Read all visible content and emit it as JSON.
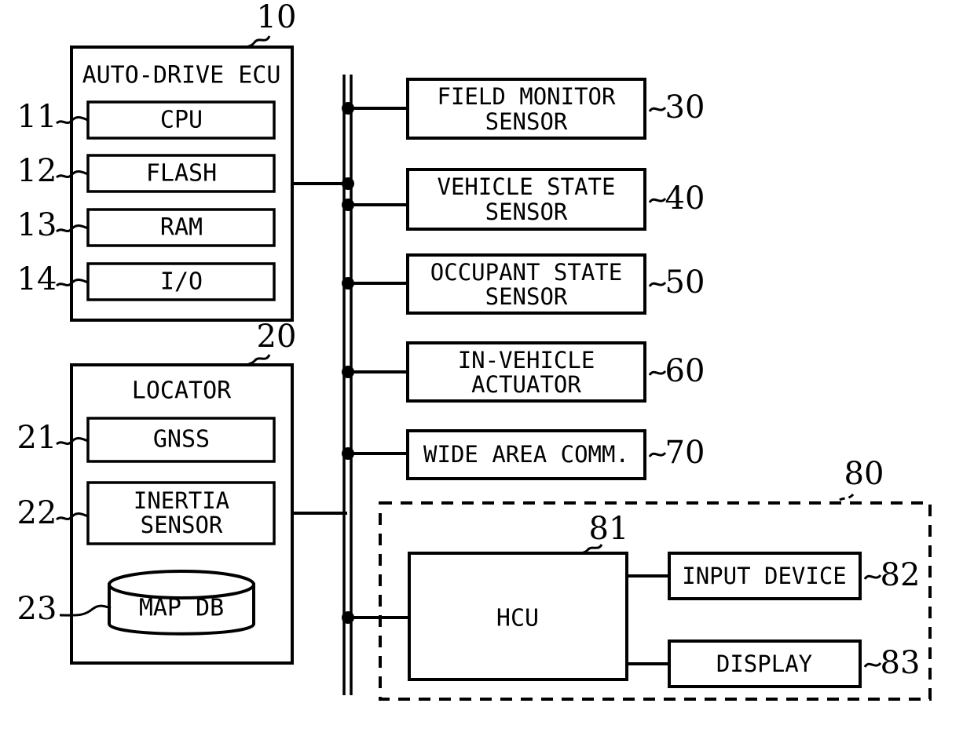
{
  "figure": {
    "type": "patent-block-diagram",
    "background": "#ffffff",
    "line_color": "#000000"
  },
  "ecu": {
    "ref": "10",
    "title": "AUTO-DRIVE ECU",
    "modules": [
      {
        "ref": "11",
        "label": "CPU"
      },
      {
        "ref": "12",
        "label": "FLASH"
      },
      {
        "ref": "13",
        "label": "RAM"
      },
      {
        "ref": "14",
        "label": "I/O"
      }
    ]
  },
  "locator": {
    "ref": "20",
    "title": "LOCATOR",
    "modules": [
      {
        "ref": "21",
        "label": "GNSS"
      },
      {
        "ref": "22",
        "label_line1": "INERTIA",
        "label_line2": "SENSOR"
      }
    ],
    "database": {
      "ref": "23",
      "label": "MAP DB"
    }
  },
  "bus_devices": [
    {
      "ref": "30",
      "line1": "FIELD MONITOR",
      "line2": "SENSOR"
    },
    {
      "ref": "40",
      "line1": "VEHICLE STATE",
      "line2": "SENSOR"
    },
    {
      "ref": "50",
      "line1": "OCCUPANT STATE",
      "line2": "SENSOR"
    },
    {
      "ref": "60",
      "line1": "IN-VEHICLE",
      "line2": "ACTUATOR"
    },
    {
      "ref": "70",
      "line1": "WIDE AREA COMM.",
      "line2": ""
    }
  ],
  "hmi_region": {
    "ref": "80",
    "hcu": {
      "ref": "81",
      "label": "HCU"
    },
    "peripherals": [
      {
        "ref": "82",
        "label": "INPUT DEVICE"
      },
      {
        "ref": "83",
        "label": "DISPLAY"
      }
    ]
  }
}
